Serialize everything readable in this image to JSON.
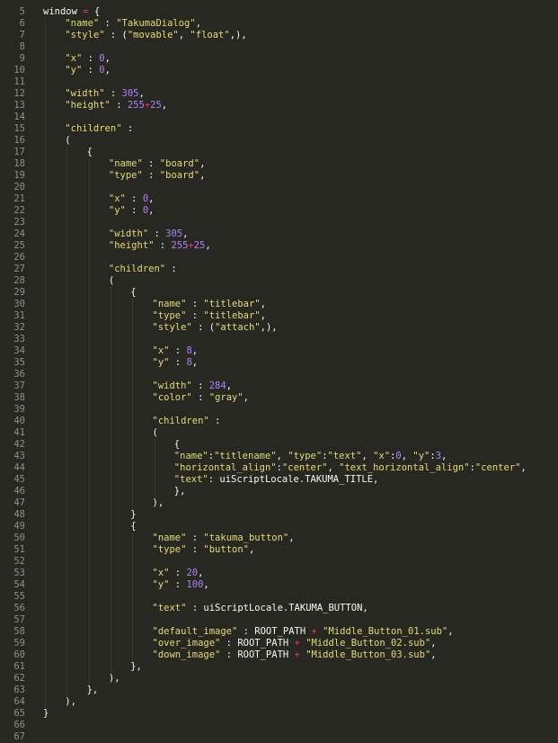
{
  "editor": {
    "theme": {
      "background": "#272822",
      "text": "#f8f8f2",
      "string": "#e6db74",
      "number": "#ae81ff",
      "operator": "#f92672",
      "gutter": "#8f908a"
    },
    "lines": [
      {
        "n": "5",
        "indent": 0,
        "tokens": [
          [
            "p",
            "window "
          ],
          [
            "o",
            "="
          ],
          [
            "p",
            " {"
          ]
        ]
      },
      {
        "n": "6",
        "indent": 1,
        "tokens": [
          [
            "s",
            "\"name\""
          ],
          [
            "p",
            " : "
          ],
          [
            "s",
            "\"TakumaDialog\""
          ],
          [
            "p",
            ","
          ]
        ]
      },
      {
        "n": "7",
        "indent": 1,
        "tokens": [
          [
            "s",
            "\"style\""
          ],
          [
            "p",
            " : ("
          ],
          [
            "s",
            "\"movable\""
          ],
          [
            "p",
            ", "
          ],
          [
            "s",
            "\"float\""
          ],
          [
            "p",
            ",),"
          ]
        ]
      },
      {
        "n": "8",
        "indent": 0,
        "tokens": []
      },
      {
        "n": "9",
        "indent": 1,
        "tokens": [
          [
            "s",
            "\"x\""
          ],
          [
            "p",
            " : "
          ],
          [
            "n",
            "0"
          ],
          [
            "p",
            ","
          ]
        ]
      },
      {
        "n": "10",
        "indent": 1,
        "tokens": [
          [
            "s",
            "\"y\""
          ],
          [
            "p",
            " : "
          ],
          [
            "n",
            "0"
          ],
          [
            "p",
            ","
          ]
        ]
      },
      {
        "n": "11",
        "indent": 0,
        "tokens": []
      },
      {
        "n": "12",
        "indent": 1,
        "tokens": [
          [
            "s",
            "\"width\""
          ],
          [
            "p",
            " : "
          ],
          [
            "n",
            "305"
          ],
          [
            "p",
            ","
          ]
        ]
      },
      {
        "n": "13",
        "indent": 1,
        "tokens": [
          [
            "s",
            "\"height\""
          ],
          [
            "p",
            " : "
          ],
          [
            "n",
            "255"
          ],
          [
            "o",
            "+"
          ],
          [
            "n",
            "25"
          ],
          [
            "p",
            ","
          ]
        ]
      },
      {
        "n": "14",
        "indent": 0,
        "tokens": []
      },
      {
        "n": "15",
        "indent": 1,
        "tokens": [
          [
            "s",
            "\"children\""
          ],
          [
            "p",
            " :"
          ]
        ]
      },
      {
        "n": "16",
        "indent": 1,
        "tokens": [
          [
            "p",
            "("
          ]
        ]
      },
      {
        "n": "17",
        "indent": 2,
        "tokens": [
          [
            "p",
            "{"
          ]
        ]
      },
      {
        "n": "18",
        "indent": 3,
        "tokens": [
          [
            "s",
            "\"name\""
          ],
          [
            "p",
            " : "
          ],
          [
            "s",
            "\"board\""
          ],
          [
            "p",
            ","
          ]
        ]
      },
      {
        "n": "19",
        "indent": 3,
        "tokens": [
          [
            "s",
            "\"type\""
          ],
          [
            "p",
            " : "
          ],
          [
            "s",
            "\"board\""
          ],
          [
            "p",
            ","
          ]
        ]
      },
      {
        "n": "20",
        "indent": 0,
        "tokens": []
      },
      {
        "n": "21",
        "indent": 3,
        "tokens": [
          [
            "s",
            "\"x\""
          ],
          [
            "p",
            " : "
          ],
          [
            "n",
            "0"
          ],
          [
            "p",
            ","
          ]
        ]
      },
      {
        "n": "22",
        "indent": 3,
        "tokens": [
          [
            "s",
            "\"y\""
          ],
          [
            "p",
            " : "
          ],
          [
            "n",
            "0"
          ],
          [
            "p",
            ","
          ]
        ]
      },
      {
        "n": "23",
        "indent": 0,
        "tokens": []
      },
      {
        "n": "24",
        "indent": 3,
        "tokens": [
          [
            "s",
            "\"width\""
          ],
          [
            "p",
            " : "
          ],
          [
            "n",
            "305"
          ],
          [
            "p",
            ","
          ]
        ]
      },
      {
        "n": "25",
        "indent": 3,
        "tokens": [
          [
            "s",
            "\"height\""
          ],
          [
            "p",
            " : "
          ],
          [
            "n",
            "255"
          ],
          [
            "o",
            "+"
          ],
          [
            "n",
            "25"
          ],
          [
            "p",
            ","
          ]
        ]
      },
      {
        "n": "26",
        "indent": 0,
        "tokens": []
      },
      {
        "n": "27",
        "indent": 3,
        "tokens": [
          [
            "s",
            "\"children\""
          ],
          [
            "p",
            " :"
          ]
        ]
      },
      {
        "n": "28",
        "indent": 3,
        "tokens": [
          [
            "p",
            "("
          ]
        ]
      },
      {
        "n": "29",
        "indent": 4,
        "tokens": [
          [
            "p",
            "{"
          ]
        ]
      },
      {
        "n": "30",
        "indent": 5,
        "tokens": [
          [
            "s",
            "\"name\""
          ],
          [
            "p",
            " : "
          ],
          [
            "s",
            "\"titlebar\""
          ],
          [
            "p",
            ","
          ]
        ]
      },
      {
        "n": "31",
        "indent": 5,
        "tokens": [
          [
            "s",
            "\"type\""
          ],
          [
            "p",
            " : "
          ],
          [
            "s",
            "\"titlebar\""
          ],
          [
            "p",
            ","
          ]
        ]
      },
      {
        "n": "32",
        "indent": 5,
        "tokens": [
          [
            "s",
            "\"style\""
          ],
          [
            "p",
            " : ("
          ],
          [
            "s",
            "\"attach\""
          ],
          [
            "p",
            ",),"
          ]
        ]
      },
      {
        "n": "33",
        "indent": 0,
        "tokens": []
      },
      {
        "n": "34",
        "indent": 5,
        "tokens": [
          [
            "s",
            "\"x\""
          ],
          [
            "p",
            " : "
          ],
          [
            "n",
            "8"
          ],
          [
            "p",
            ","
          ]
        ]
      },
      {
        "n": "35",
        "indent": 5,
        "tokens": [
          [
            "s",
            "\"y\""
          ],
          [
            "p",
            " : "
          ],
          [
            "n",
            "8"
          ],
          [
            "p",
            ","
          ]
        ]
      },
      {
        "n": "36",
        "indent": 0,
        "tokens": []
      },
      {
        "n": "37",
        "indent": 5,
        "tokens": [
          [
            "s",
            "\"width\""
          ],
          [
            "p",
            " : "
          ],
          [
            "n",
            "284"
          ],
          [
            "p",
            ","
          ]
        ]
      },
      {
        "n": "38",
        "indent": 5,
        "tokens": [
          [
            "s",
            "\"color\""
          ],
          [
            "p",
            " : "
          ],
          [
            "s",
            "\"gray\""
          ],
          [
            "p",
            ","
          ]
        ]
      },
      {
        "n": "39",
        "indent": 0,
        "tokens": []
      },
      {
        "n": "40",
        "indent": 5,
        "tokens": [
          [
            "s",
            "\"children\""
          ],
          [
            "p",
            " :"
          ]
        ]
      },
      {
        "n": "41",
        "indent": 5,
        "tokens": [
          [
            "p",
            "("
          ]
        ]
      },
      {
        "n": "42",
        "indent": 6,
        "tokens": [
          [
            "p",
            "{"
          ]
        ]
      },
      {
        "n": "43",
        "indent": 6,
        "tokens": [
          [
            "s",
            "\"name\""
          ],
          [
            "p",
            ":"
          ],
          [
            "s",
            "\"titlename\""
          ],
          [
            "p",
            ", "
          ],
          [
            "s",
            "\"type\""
          ],
          [
            "p",
            ":"
          ],
          [
            "s",
            "\"text\""
          ],
          [
            "p",
            ", "
          ],
          [
            "s",
            "\"x\""
          ],
          [
            "p",
            ":"
          ],
          [
            "n",
            "0"
          ],
          [
            "p",
            ", "
          ],
          [
            "s",
            "\"y\""
          ],
          [
            "p",
            ":"
          ],
          [
            "n",
            "3"
          ],
          [
            "p",
            ","
          ]
        ]
      },
      {
        "n": "44",
        "indent": 6,
        "tokens": [
          [
            "s",
            "\"horizontal_align\""
          ],
          [
            "p",
            ":"
          ],
          [
            "s",
            "\"center\""
          ],
          [
            "p",
            ", "
          ],
          [
            "s",
            "\"text_horizontal_align\""
          ],
          [
            "p",
            ":"
          ],
          [
            "s",
            "\"center\""
          ],
          [
            "p",
            ","
          ]
        ]
      },
      {
        "n": "45",
        "indent": 6,
        "tokens": [
          [
            "s",
            "\"text\""
          ],
          [
            "p",
            ": uiScriptLocale.TAKUMA_TITLE,"
          ]
        ]
      },
      {
        "n": "46",
        "indent": 6,
        "tokens": [
          [
            "p",
            "},"
          ]
        ]
      },
      {
        "n": "47",
        "indent": 5,
        "tokens": [
          [
            "p",
            "),"
          ]
        ]
      },
      {
        "n": "48",
        "indent": 4,
        "tokens": [
          [
            "p",
            "}"
          ]
        ]
      },
      {
        "n": "49",
        "indent": 4,
        "tokens": [
          [
            "p",
            "{"
          ]
        ]
      },
      {
        "n": "50",
        "indent": 5,
        "tokens": [
          [
            "s",
            "\"name\""
          ],
          [
            "p",
            " : "
          ],
          [
            "s",
            "\"takuma_button\""
          ],
          [
            "p",
            ","
          ]
        ]
      },
      {
        "n": "51",
        "indent": 5,
        "tokens": [
          [
            "s",
            "\"type\""
          ],
          [
            "p",
            " : "
          ],
          [
            "s",
            "\"button\""
          ],
          [
            "p",
            ","
          ]
        ]
      },
      {
        "n": "52",
        "indent": 0,
        "tokens": []
      },
      {
        "n": "53",
        "indent": 5,
        "tokens": [
          [
            "s",
            "\"x\""
          ],
          [
            "p",
            " : "
          ],
          [
            "n",
            "20"
          ],
          [
            "p",
            ","
          ]
        ]
      },
      {
        "n": "54",
        "indent": 5,
        "tokens": [
          [
            "s",
            "\"y\""
          ],
          [
            "p",
            " : "
          ],
          [
            "n",
            "100"
          ],
          [
            "p",
            ","
          ]
        ]
      },
      {
        "n": "55",
        "indent": 0,
        "tokens": []
      },
      {
        "n": "56",
        "indent": 5,
        "tokens": [
          [
            "s",
            "\"text\""
          ],
          [
            "p",
            " : uiScriptLocale.TAKUMA_BUTTON,"
          ]
        ]
      },
      {
        "n": "57",
        "indent": 0,
        "tokens": []
      },
      {
        "n": "58",
        "indent": 5,
        "tokens": [
          [
            "s",
            "\"default_image\""
          ],
          [
            "p",
            " : ROOT_PATH "
          ],
          [
            "o",
            "+"
          ],
          [
            "p",
            " "
          ],
          [
            "s",
            "\"Middle_Button_01.sub\""
          ],
          [
            "p",
            ","
          ]
        ]
      },
      {
        "n": "59",
        "indent": 5,
        "tokens": [
          [
            "s",
            "\"over_image\""
          ],
          [
            "p",
            " : ROOT_PATH "
          ],
          [
            "o",
            "+"
          ],
          [
            "p",
            " "
          ],
          [
            "s",
            "\"Middle_Button_02.sub\""
          ],
          [
            "p",
            ","
          ]
        ]
      },
      {
        "n": "60",
        "indent": 5,
        "tokens": [
          [
            "s",
            "\"down_image\""
          ],
          [
            "p",
            " : ROOT_PATH "
          ],
          [
            "o",
            "+"
          ],
          [
            "p",
            " "
          ],
          [
            "s",
            "\"Middle_Button_03.sub\""
          ],
          [
            "p",
            ","
          ]
        ]
      },
      {
        "n": "61",
        "indent": 4,
        "tokens": [
          [
            "p",
            "},"
          ]
        ]
      },
      {
        "n": "62",
        "indent": 3,
        "tokens": [
          [
            "p",
            "),"
          ]
        ]
      },
      {
        "n": "63",
        "indent": 2,
        "tokens": [
          [
            "p",
            "},"
          ]
        ]
      },
      {
        "n": "64",
        "indent": 1,
        "tokens": [
          [
            "p",
            "),"
          ]
        ]
      },
      {
        "n": "65",
        "indent": 0,
        "tokens": [
          [
            "p",
            "}"
          ]
        ]
      },
      {
        "n": "66",
        "indent": 0,
        "tokens": []
      },
      {
        "n": "67",
        "indent": 0,
        "tokens": []
      }
    ]
  }
}
